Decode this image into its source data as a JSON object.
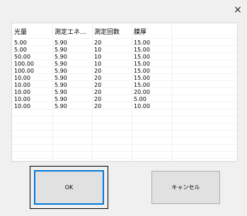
{
  "window": {
    "close_glyph": "×"
  },
  "list": {
    "columns": [
      "光量",
      "測定エネ...",
      "測定回数",
      "膜厚"
    ],
    "rows": [
      [
        "5.00",
        "5.90",
        "20",
        "15.00"
      ],
      [
        "5.00",
        "5.90",
        "10",
        "15.00"
      ],
      [
        "50.00",
        "5.90",
        "10",
        "15.00"
      ],
      [
        "100.00",
        "5.90",
        "10",
        "15.00"
      ],
      [
        "100.00",
        "5.90",
        "20",
        "15.00"
      ],
      [
        "10.00",
        "5.90",
        "20",
        "15.00"
      ],
      [
        "10.00",
        "5.90",
        "20",
        "15.00"
      ],
      [
        "10.00",
        "5.90",
        "20",
        "20.00"
      ],
      [
        "10.00",
        "5.90",
        "20",
        "5.00"
      ],
      [
        "10.00",
        "5.90",
        "20",
        "10.00"
      ]
    ]
  },
  "buttons": {
    "ok_label": "OK",
    "cancel_label": "キャンセル"
  },
  "colors": {
    "focus_border": "#0078d7",
    "button_face": "#e1e1e1"
  }
}
